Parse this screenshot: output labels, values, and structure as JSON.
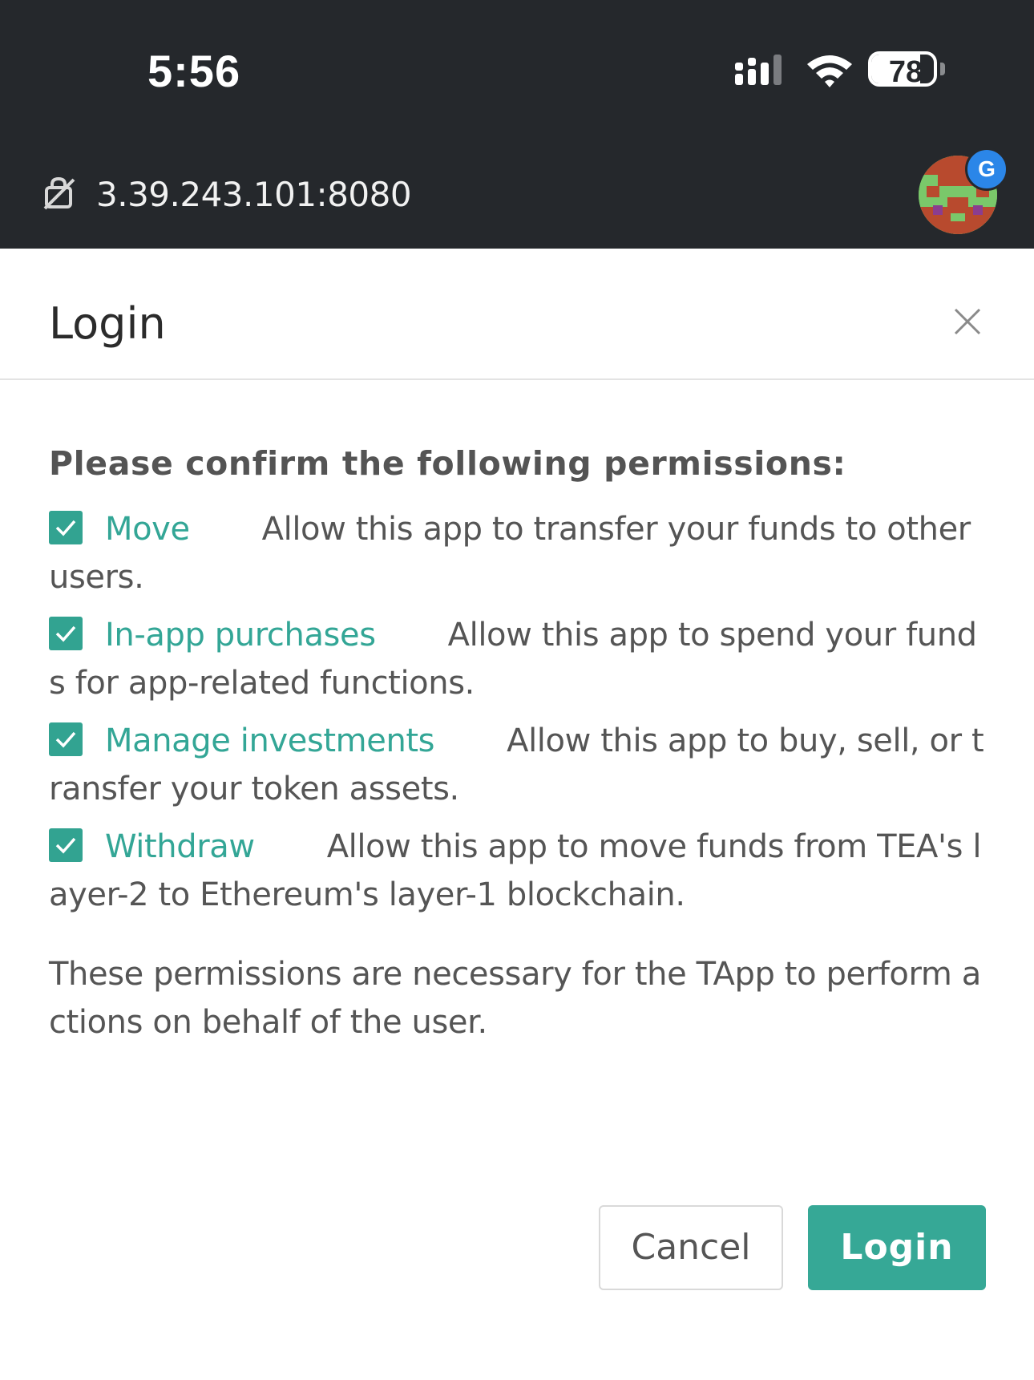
{
  "status_bar": {
    "time": "5:56",
    "battery_percent": "78",
    "battery_level": 0.78,
    "icons": [
      "signal-icon",
      "wifi-icon",
      "battery-icon"
    ]
  },
  "browser": {
    "url": "3.39.243.101:8080",
    "security_icon": "not-secure-icon",
    "profile_badge": "G",
    "colors": {
      "bar_bg": "#25282c"
    }
  },
  "modal": {
    "title": "Login",
    "close_icon": "close-icon",
    "heading": "Please confirm the following permissions:",
    "permissions": [
      {
        "name": "Move",
        "checked": true,
        "description": "Allow this app to transfer your funds to other users."
      },
      {
        "name": "In-app purchases",
        "checked": true,
        "description": "Allow this app to spend your funds for app-related functions."
      },
      {
        "name": "Manage investments",
        "checked": true,
        "description": "Allow this app to buy, sell, or transfer your token assets."
      },
      {
        "name": "Withdraw",
        "checked": true,
        "description": "Allow this app to move funds from TEA's layer-2 to Ethereum's layer-1 blockchain."
      }
    ],
    "note": "These permissions are necessary for the TApp to perform actions on behalf of the user.",
    "cancel_label": "Cancel",
    "login_label": "Login",
    "colors": {
      "accent": "#36a896"
    }
  }
}
